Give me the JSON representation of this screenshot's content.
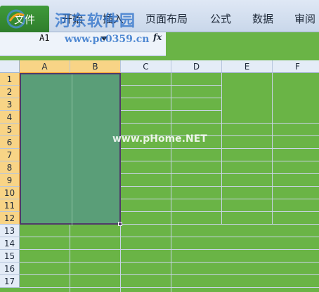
{
  "ribbon": {
    "file_tab": "文件",
    "tabs": [
      "开始",
      "插入",
      "页面布局",
      "公式",
      "数据",
      "审阅"
    ]
  },
  "watermark": {
    "title": "河东软件园",
    "url": "www.pc0359.cn",
    "center": "www.pHome.NET"
  },
  "formula_bar": {
    "name_box_value": "A1",
    "fx_label": "fx"
  },
  "sheet": {
    "columns": [
      "A",
      "B",
      "C",
      "D",
      "E",
      "F"
    ],
    "rows": [
      "1",
      "2",
      "3",
      "4",
      "5",
      "6",
      "7",
      "8",
      "9",
      "10",
      "11",
      "12",
      "13",
      "14",
      "15",
      "16",
      "17"
    ],
    "selected_range": "A1:B12"
  },
  "colors": {
    "sheet_fill": "#6ab446",
    "selection_fill": "#5a9e78",
    "selected_header": "#f8d486"
  }
}
